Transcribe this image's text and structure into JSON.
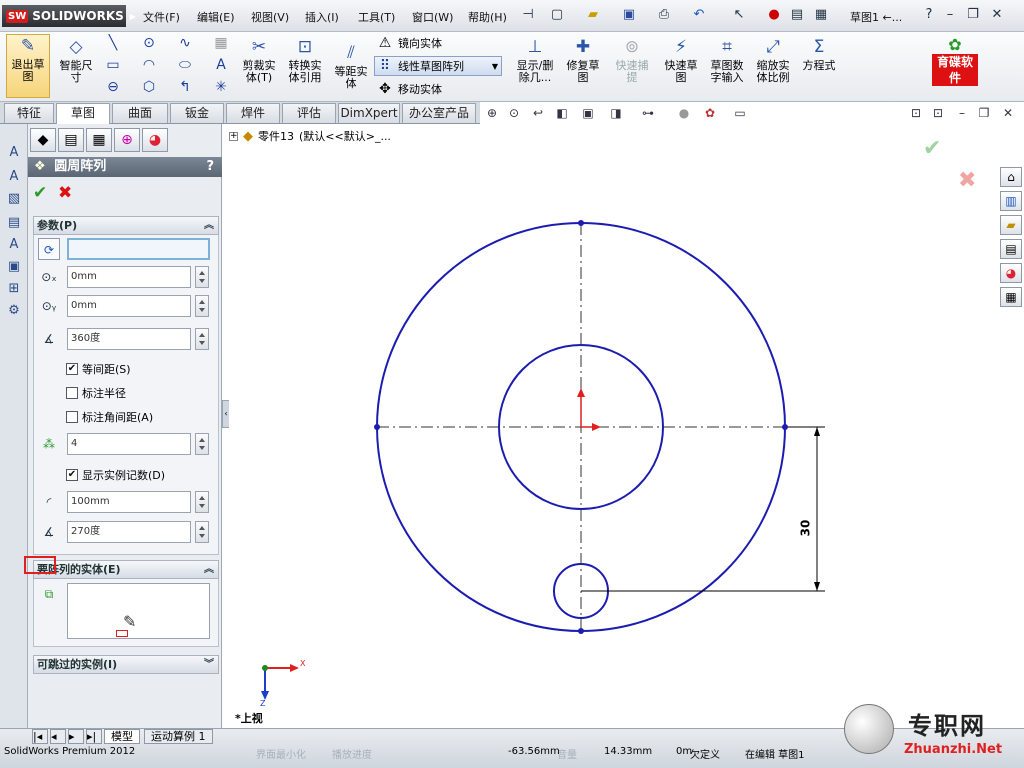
{
  "app": {
    "brand": "SOLIDWORKS",
    "brand_badge": "SW"
  },
  "menu": [
    "文件(F)",
    "编辑(E)",
    "视图(V)",
    "插入(I)",
    "工具(T)",
    "窗口(W)",
    "帮助(H)"
  ],
  "title_doc": "草图1 ←...",
  "ribbon": {
    "exit_sketch": "退出草图",
    "smart_dim": "智能尺寸",
    "trim": "剪裁实体(T)",
    "convert": "转换实体引用",
    "offset": "等距实体",
    "mirror": "镜向实体",
    "linear_pattern": "线性草图阵列",
    "move": "移动实体",
    "show_hide": "显示/删除几...",
    "repair": "修复草图",
    "quick_snap": "快速捕提",
    "quick_sketch": "快速草图",
    "numeric_input": "草图数字输入",
    "scale": "缩放实体比例",
    "equation": "方程式",
    "brand_logo": "育碟软件"
  },
  "tabs": [
    "特征",
    "草图",
    "曲面",
    "钣金",
    "焊件",
    "评估",
    "DimXpert",
    "办公室产品"
  ],
  "active_tab": "草图",
  "tree": {
    "part": "零件13",
    "config": "(默认<<默认>_..."
  },
  "pm": {
    "title": "圆周阵列",
    "help": "?",
    "sec_params": "参数(P)",
    "x": "0mm",
    "y": "0mm",
    "angle": "360度",
    "equal_spacing": "等间距(S)",
    "dim_radius": "标注半径",
    "dim_angle": "标注角间距(A)",
    "count": "4",
    "show_count": "显示实例记数(D)",
    "radius": "100mm",
    "arc_angle": "270度",
    "sec_entities": "要阵列的实体(E)",
    "sec_skip": "可跳过的实例(I)"
  },
  "drawing": {
    "dim_value": "30",
    "view_label": "*上视",
    "axis_x": "X",
    "axis_z": "Z",
    "line_color": "#1c1cb0"
  },
  "bottom_tabs": [
    "模型",
    "运动算例 1"
  ],
  "status": {
    "app": "SolidWorks Premium 2012",
    "x": "-63.56mm",
    "y": "14.33mm",
    "z": "0m",
    "defined": "欠定义",
    "editing": "在编辑 草图1",
    "faded": [
      "界面最小化",
      "播放进度",
      "音量"
    ]
  },
  "watermark": {
    "brand": "专职网",
    "url": "Zhuanzhi.Net"
  }
}
